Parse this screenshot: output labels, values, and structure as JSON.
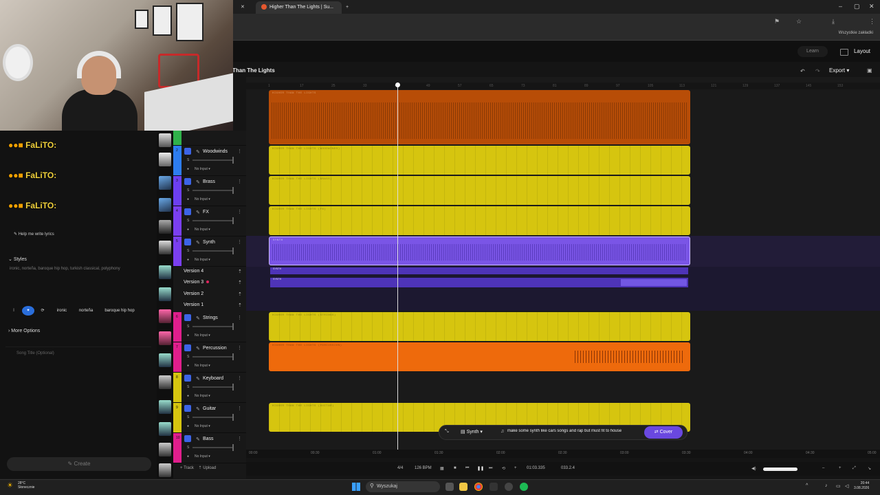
{
  "browser": {
    "active_tab": "Higher Than The Lights | Su...",
    "bookmarks_label": "Wszystkie zakładki"
  },
  "app": {
    "learn": "Learn",
    "layout": "Layout",
    "song_title": "Than The Lights",
    "export": "Export"
  },
  "chat": {
    "lines": [
      "FaLiTO:",
      "FaLiTO:",
      "FaLiTO:"
    ]
  },
  "sidebar": {
    "lyrics_button": "Help me write lyrics",
    "styles_header": "Styles",
    "styles_placeholder": "ironic, norteña, baroque hip hop, turkish classical, polyphony",
    "style_tags": [
      "ironic",
      "norteña",
      "baroque hip hop"
    ],
    "more_options": "More Options",
    "song_title_placeholder": "Song Title (Optional)",
    "create": "Create"
  },
  "tracks": [
    {
      "num": "2",
      "name": "Woodwinds",
      "input": "No Input",
      "color": "#2d7df0"
    },
    {
      "num": "3",
      "name": "Brass",
      "input": "No Input",
      "color": "#6c3ff0"
    },
    {
      "num": "4",
      "name": "FX",
      "input": "No Input",
      "color": "#7a3ff0"
    },
    {
      "num": "5",
      "name": "Synth",
      "input": "No Input",
      "color": "#7a3ff0"
    },
    {
      "num": "6",
      "name": "Strings",
      "input": "No Input",
      "color": "#e01e8c"
    },
    {
      "num": "7",
      "name": "Percussion",
      "input": "No Input",
      "color": "#e01e8c"
    },
    {
      "num": "8",
      "name": "Keyboard",
      "input": "No Input",
      "color": "#d6c50f"
    },
    {
      "num": "9",
      "name": "Guitar",
      "input": "No Input",
      "color": "#d6c50f"
    },
    {
      "num": "10",
      "name": "Bass",
      "input": "No Input",
      "color": "#e01e8c"
    }
  ],
  "versions": [
    "Version 4",
    "Version 3",
    "Version 2",
    "Version 1"
  ],
  "track_footer": {
    "add_track": "+ Track",
    "upload": "Upload"
  },
  "clips": {
    "main": "HIGHER THAN THE LIGHTS",
    "woodwinds": "HIGHER THAN THE LIGHTS (WOODWINDS)",
    "brass": "HIGHER THAN THE LIGHTS (BRASS)",
    "fx": "HIGHER THAN THE LIGHTS (FX)",
    "synth": "SYNTH",
    "strings": "HIGHER THAN THE LIGHTS (STRINGS)",
    "percussion": "HIGHER THAN THE LIGHTS (PERCUSSION)",
    "guitar": "HIGHER THAN THE LIGHTS (GUITAR)"
  },
  "ruler_ticks": [
    "1",
    "17",
    "25",
    "33",
    "41",
    "49",
    "57",
    "65",
    "73",
    "81",
    "89",
    "97",
    "105",
    "113",
    "121",
    "129",
    "137",
    "145",
    "153"
  ],
  "time_ticks": [
    "00:00",
    "00:30",
    "01:00",
    "01:30",
    "02:00",
    "02:30",
    "03:00",
    "03:30",
    "04:00",
    "04:30",
    "05:00"
  ],
  "prompt": {
    "instrument": "Synth",
    "text": "make some synth like cars songs and rap but must fit to house",
    "cover": "Cover"
  },
  "transport": {
    "meter": "4/4",
    "bpm": "126 BPM",
    "time": "01:03.335",
    "bars": "033.2.4"
  },
  "taskbar": {
    "weather_temp": "28°C",
    "weather_desc": "Słonecznie",
    "search": "Wyszukaj",
    "time": "20:44",
    "date": "3.08.2026"
  }
}
